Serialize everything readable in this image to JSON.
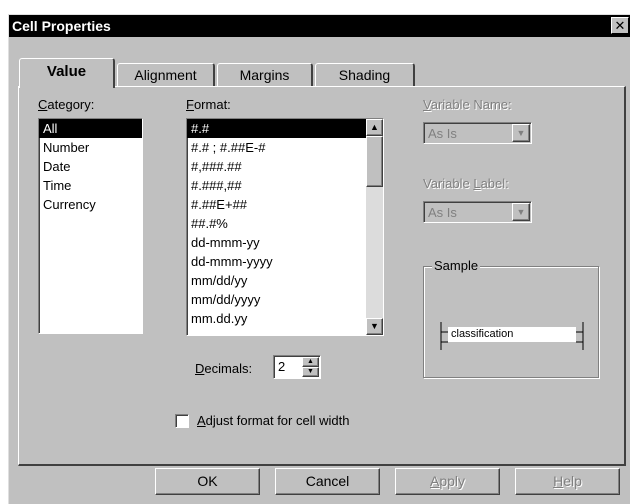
{
  "window": {
    "title": "Cell Properties",
    "close_glyph": "✕"
  },
  "tabs": [
    {
      "label": "Value",
      "active": true
    },
    {
      "label": "Alignment",
      "active": false
    },
    {
      "label": "Margins",
      "active": false
    },
    {
      "label": "Shading",
      "active": false
    }
  ],
  "category": {
    "label_mnemonic": "C",
    "label_rest": "ategory:",
    "items": [
      "All",
      "Number",
      "Date",
      "Time",
      "Currency"
    ],
    "selected": "All"
  },
  "format": {
    "label_mnemonic": "F",
    "label_rest": "ormat:",
    "items": [
      "#.#",
      "#.# ; #.##E-#",
      "#,###.##",
      "#.###,##",
      "#.##E+##",
      "##.#%",
      "dd-mmm-yy",
      "dd-mmm-yyyy",
      "mm/dd/yy",
      "mm/dd/yyyy",
      "mm.dd.yy"
    ],
    "selected": "#.#"
  },
  "decimals": {
    "label_mnemonic": "D",
    "label_rest": "ecimals:",
    "value": "2"
  },
  "variable_name": {
    "label_pre": "",
    "label_mnemonic": "V",
    "label_rest": "ariable Name:",
    "value": "As Is"
  },
  "variable_label": {
    "label_pre": "Variable ",
    "label_mnemonic": "L",
    "label_rest": "abel:",
    "value": "As Is"
  },
  "sample": {
    "legend": "Sample",
    "text": "classification"
  },
  "adjust": {
    "label_mnemonic": "A",
    "label_rest": "djust format for cell width",
    "checked": false
  },
  "buttons": {
    "ok": "OK",
    "cancel": "Cancel",
    "apply_mnemonic": "A",
    "apply_rest": "pply",
    "help_mnemonic": "H",
    "help_rest": "elp"
  },
  "icons": {
    "scroll_up": "▲",
    "scroll_down": "▼",
    "dropdown": "▼",
    "spin_up": "▲",
    "spin_down": "▼"
  }
}
